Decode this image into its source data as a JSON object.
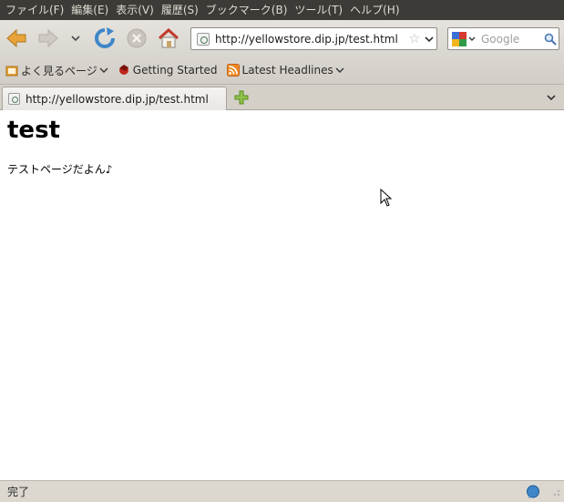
{
  "menu": {
    "items": [
      "ファイル(F)",
      "編集(E)",
      "表示(V)",
      "履歴(S)",
      "ブックマーク(B)",
      "ツール(T)",
      "ヘルプ(H)"
    ]
  },
  "navbar": {
    "back_icon": "back-arrow-icon",
    "forward_icon": "forward-arrow-icon",
    "history_icon": "chevron-down-icon",
    "reload_icon": "reload-icon",
    "stop_icon": "stop-icon",
    "home_icon": "home-icon"
  },
  "urlbar": {
    "value": "http://yellowstore.dip.jp/test.html"
  },
  "search": {
    "placeholder": "Google",
    "engine_icon": "google-icon"
  },
  "bookmarks": {
    "items": [
      {
        "label": "よく見るページ",
        "icon": "folder-icon"
      },
      {
        "label": "Getting Started",
        "icon": "firefox-icon"
      },
      {
        "label": "Latest Headlines",
        "icon": "rss-icon"
      }
    ]
  },
  "tabs": [
    {
      "label": "http://yellowstore.dip.jp/test.html"
    }
  ],
  "page": {
    "heading": "test",
    "paragraph": "テストページだよん♪"
  },
  "status": {
    "text": "完了"
  },
  "colors": {
    "menubar_bg": "#3c3b37",
    "menubar_text": "#dfdbd2",
    "toolbar_bg": "#d9d5cf",
    "accent_orange": "#e8a33a",
    "reload_blue": "#3f86c9"
  }
}
